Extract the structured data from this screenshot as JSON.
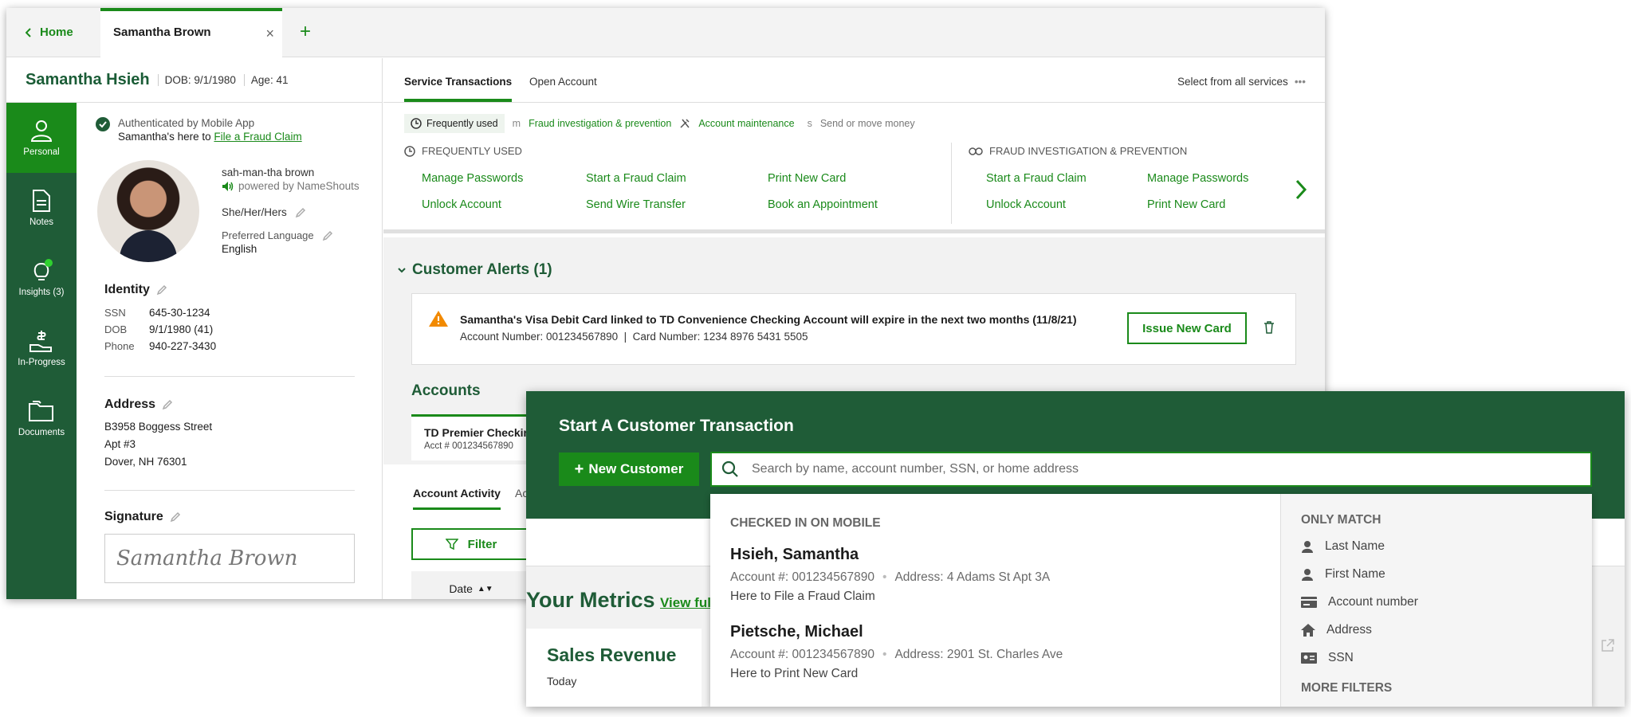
{
  "tabs": {
    "home": "Home",
    "customer": "Samantha Brown",
    "close": "×",
    "add": "+"
  },
  "header": {
    "name": "Samantha Hsieh",
    "dob": "DOB: 9/1/1980",
    "age": "Age: 41"
  },
  "rail": [
    {
      "label": "Personal"
    },
    {
      "label": "Notes"
    },
    {
      "label": "Insights (3)"
    },
    {
      "label": "In-Progress"
    },
    {
      "label": "Documents"
    }
  ],
  "auth": {
    "line1": "Authenticated by Mobile App",
    "line2_prefix": "Samantha's here to ",
    "line2_link": "File a Fraud Claim"
  },
  "pronunciation": {
    "text": "sah-man-tha brown",
    "powered": "powered by NameShouts"
  },
  "pronouns": "She/Her/Hers",
  "language": {
    "label": "Preferred Language",
    "value": "English"
  },
  "identity": {
    "title": "Identity",
    "rows": [
      {
        "k": "SSN",
        "v": "645-30-1234"
      },
      {
        "k": "DOB",
        "v": "9/1/1980 (41)"
      },
      {
        "k": "Phone",
        "v": "940-227-3430"
      }
    ]
  },
  "address": {
    "title": "Address",
    "lines": [
      "B3958 Boggess Street",
      "Apt #3",
      "Dover, NH 76301"
    ]
  },
  "signature": {
    "title": "Signature",
    "value": "Samantha Brown"
  },
  "services": {
    "tabs": [
      "Service Transactions",
      "Open Account"
    ],
    "select_all": "Select from all services",
    "chips": [
      {
        "key": "",
        "label": "Frequently used"
      },
      {
        "key": "m",
        "label": "Fraud investigation & prevention"
      },
      {
        "key": "",
        "label": "Account maintenance"
      },
      {
        "key": "s",
        "label": "Send or move money"
      }
    ],
    "freq": {
      "title": "FREQUENTLY USED",
      "links": [
        "Manage Passwords",
        "Start a Fraud Claim",
        "Print New Card",
        "Unlock Account",
        "Send Wire Transfer",
        "Book an Appointment"
      ]
    },
    "fraud": {
      "title": "FRAUD INVESTIGATION & PREVENTION",
      "links": [
        "Start a Fraud Claim",
        "Manage Passwords",
        "Unlock Account",
        "Print New Card"
      ]
    }
  },
  "alerts": {
    "title": "Customer Alerts (1)",
    "message": "Samantha's Visa Debit Card linked to TD Convenience Checking Account will expire in the next two months (11/8/21)",
    "detail": "Account Number: 001234567890  |  Card Number: 1234 8976 5431 5505",
    "action": "Issue New Card"
  },
  "accounts": {
    "title": "Accounts",
    "card_name": "TD Premier Checkin",
    "card_acct": "Acct # 001234567890",
    "tabs": [
      "Account Activity",
      "Ac"
    ],
    "filter": "Filter",
    "col_date": "Date"
  },
  "transaction": {
    "title": "Start A Customer Transaction",
    "new_customer": "New Customer",
    "search_placeholder": "Search by name, account number, SSN, or home address",
    "checked_in": "CHECKED IN ON MOBILE",
    "results": [
      {
        "name": "Hsieh, Samantha",
        "account": "Account #: 001234567890",
        "address": "Address: 4 Adams St Apt 3A",
        "note": "Here to File a Fraud Claim"
      },
      {
        "name": "Pietsche, Michael",
        "account": "Account #: 001234567890",
        "address": "Address:  2901 St. Charles Ave",
        "note": "Here to Print New Card"
      }
    ],
    "only_match": "ONLY MATCH",
    "filters": [
      {
        "label": "Last Name",
        "icon": "person-icon"
      },
      {
        "label": "First Name",
        "icon": "person-icon"
      },
      {
        "label": "Account number",
        "icon": "card-icon"
      },
      {
        "label": "Address",
        "icon": "home-icon"
      },
      {
        "label": "SSN",
        "icon": "id-card-icon"
      }
    ],
    "more_filters": "MORE FILTERS"
  },
  "metrics": {
    "title": "Your Metrics",
    "link": "View ful",
    "sales_title": "Sales Revenue",
    "period": "Today"
  },
  "colors": {
    "brand_green": "#1a8a1a",
    "dark_green": "#1f5c37",
    "warning": "#f28a00"
  }
}
